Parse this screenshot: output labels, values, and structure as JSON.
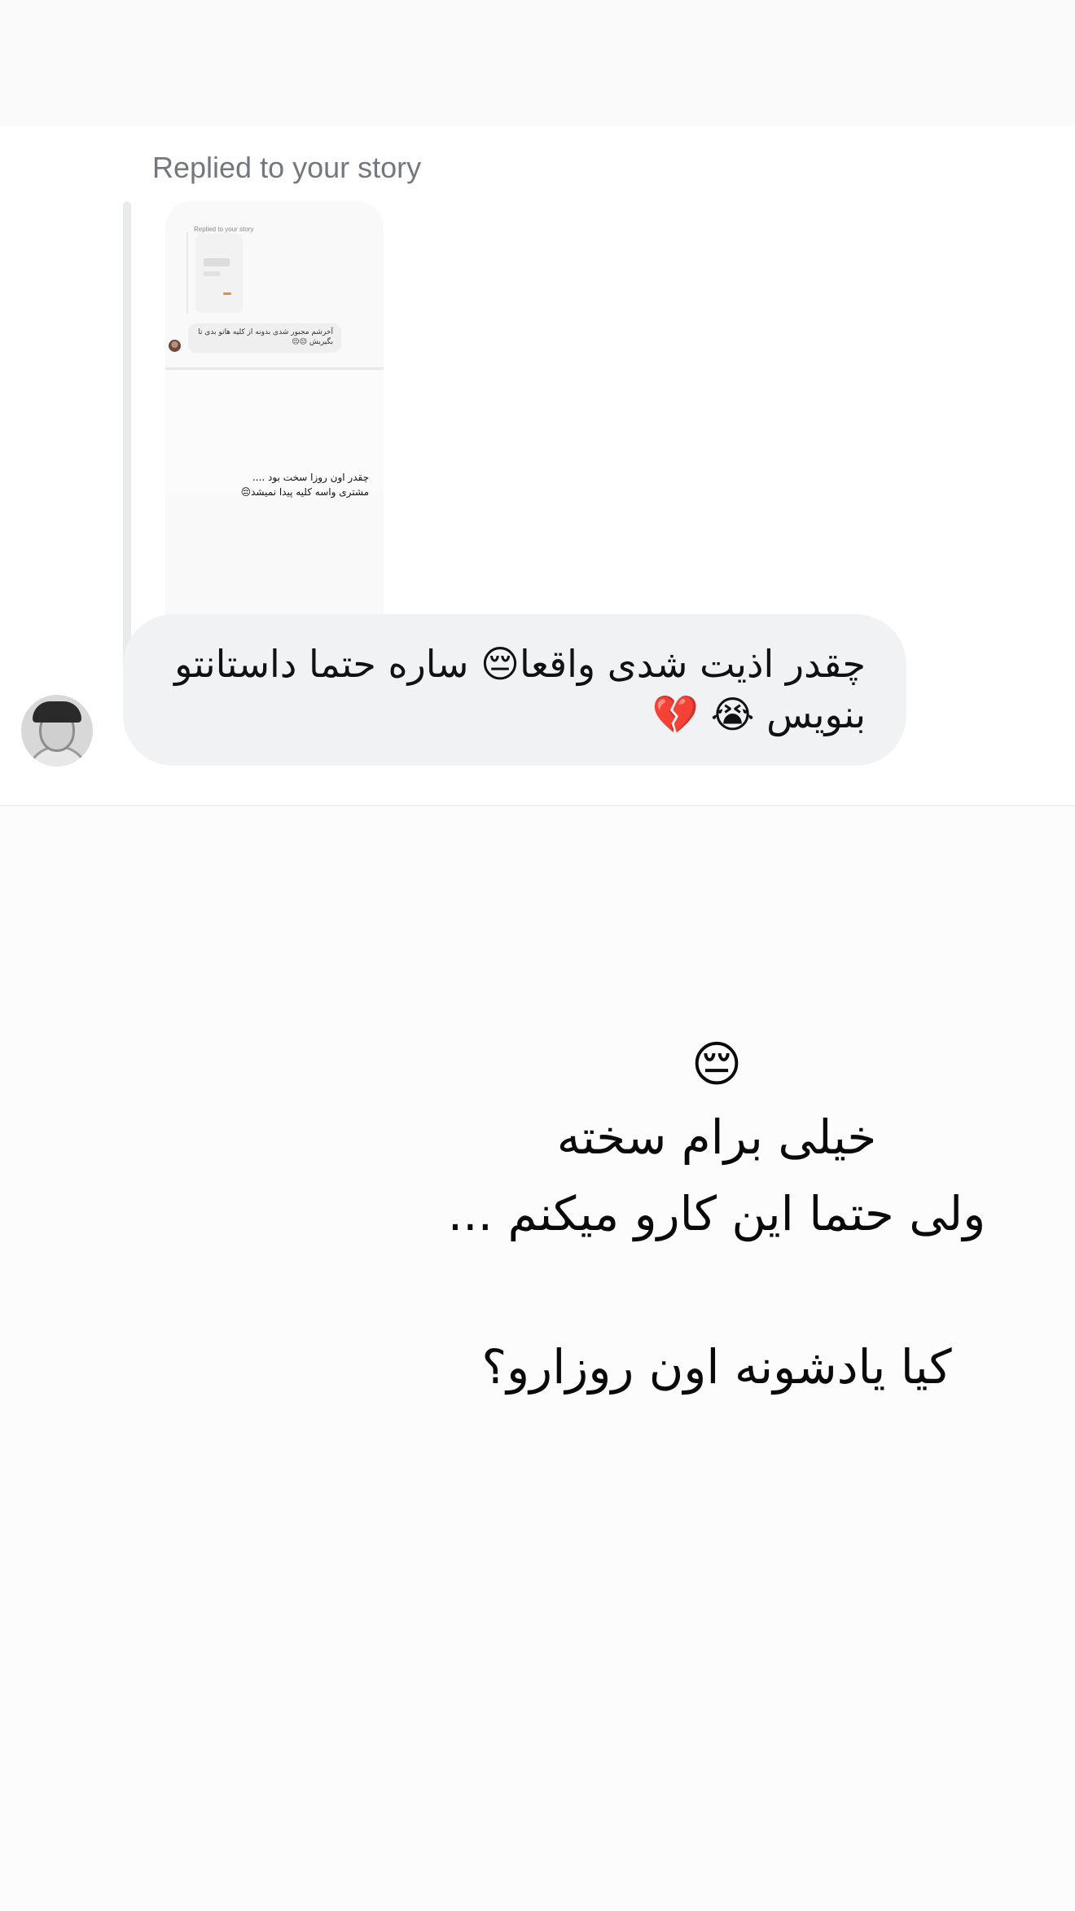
{
  "reply": {
    "label": "Replied to your story"
  },
  "story_thumbnail": {
    "label": "Replied to your story",
    "bubble_text": "آخرشم مجبور شدی بدونه از کلیه هاتو بدی تا بگیریش 😔😔",
    "story_text": "چقدر اون روزا سخت بود ....\nمشتری واسه کلیه پیدا نمیشد😔"
  },
  "message": {
    "text": "چقدر اذیت شدی واقعا😔 ساره حتما داستانتو بنویس 😭 💔"
  },
  "story": {
    "emoji": "😔",
    "line1": "خیلی برام سخته",
    "line2": "ولی حتما این کارو میکنم ...",
    "line3": "کیا یادشونه اون روزارو؟"
  }
}
